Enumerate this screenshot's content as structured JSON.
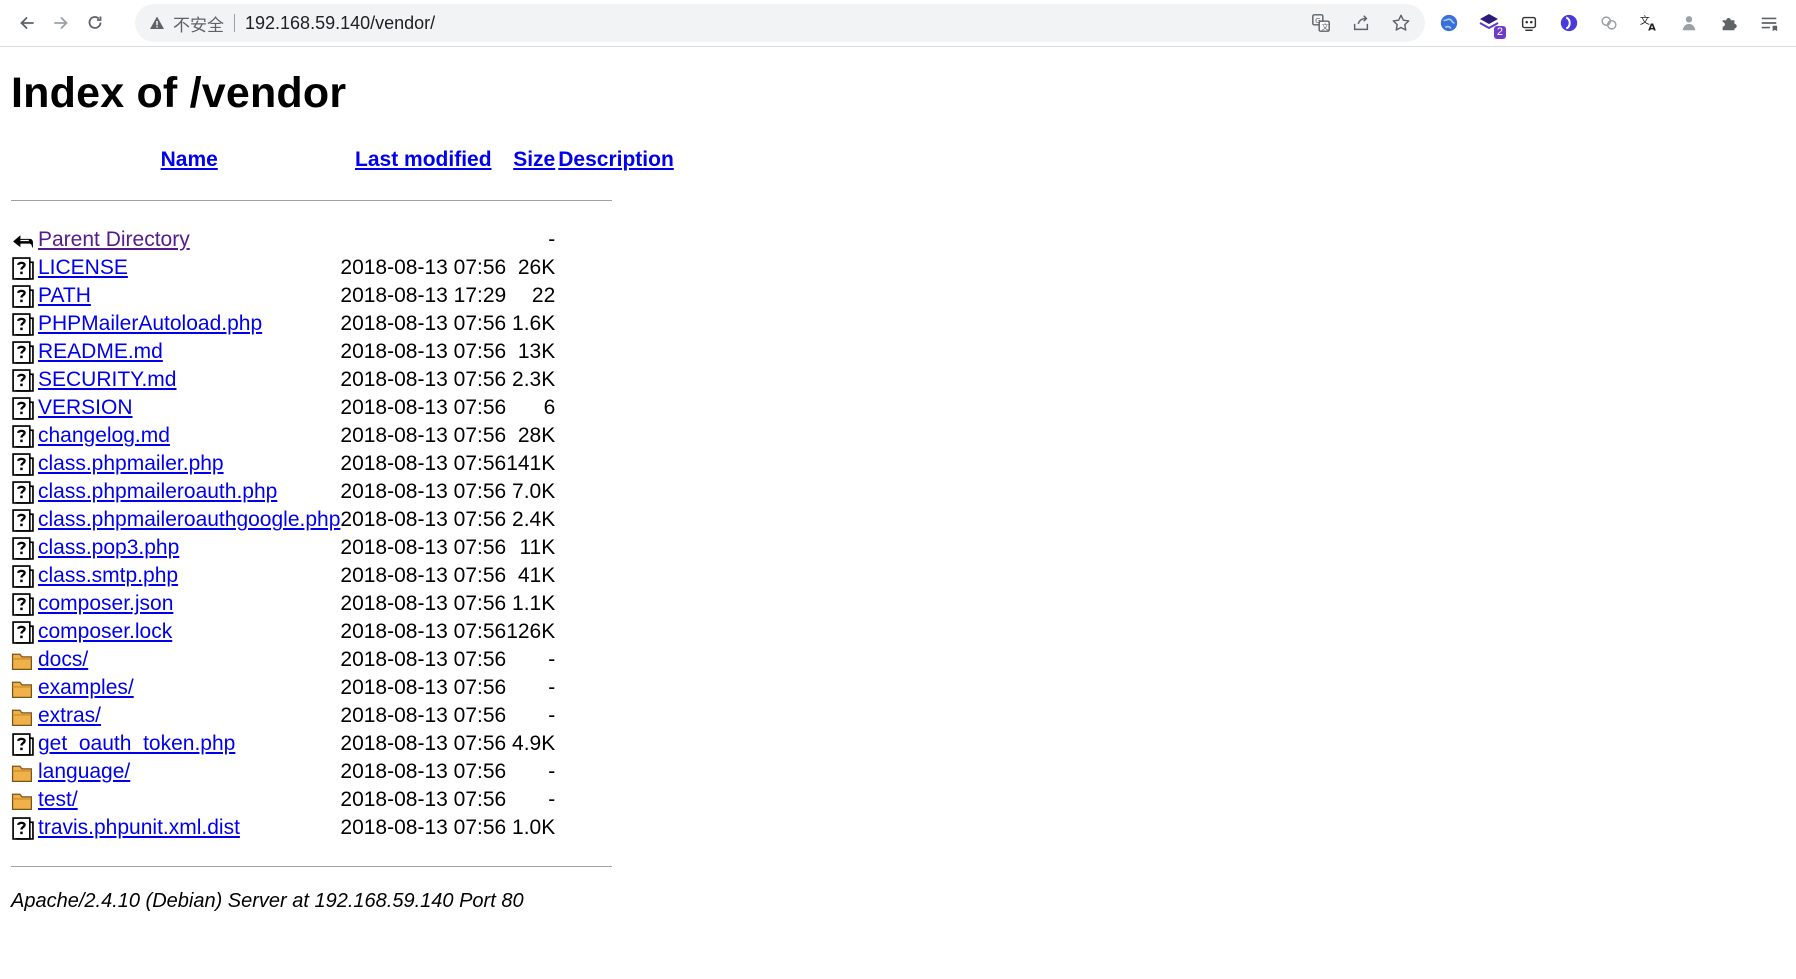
{
  "browser": {
    "security_label": "不安全",
    "url": "192.168.59.140/vendor/",
    "extension_badge": "2"
  },
  "page": {
    "title": "Index of /vendor",
    "columns": {
      "name": "Name",
      "last_modified": "Last modified",
      "size": "Size",
      "description": "Description"
    },
    "parent": {
      "label": "Parent Directory",
      "size": "-"
    },
    "entries": [
      {
        "name": "LICENSE",
        "date": "2018-08-13 07:56",
        "size": "26K",
        "type": "file"
      },
      {
        "name": "PATH",
        "date": "2018-08-13 17:29",
        "size": "22",
        "type": "file"
      },
      {
        "name": "PHPMailerAutoload.php",
        "date": "2018-08-13 07:56",
        "size": "1.6K",
        "type": "file"
      },
      {
        "name": "README.md",
        "date": "2018-08-13 07:56",
        "size": "13K",
        "type": "file"
      },
      {
        "name": "SECURITY.md",
        "date": "2018-08-13 07:56",
        "size": "2.3K",
        "type": "file"
      },
      {
        "name": "VERSION",
        "date": "2018-08-13 07:56",
        "size": "6",
        "type": "file"
      },
      {
        "name": "changelog.md",
        "date": "2018-08-13 07:56",
        "size": "28K",
        "type": "file"
      },
      {
        "name": "class.phpmailer.php",
        "date": "2018-08-13 07:56",
        "size": "141K",
        "type": "file"
      },
      {
        "name": "class.phpmaileroauth.php",
        "date": "2018-08-13 07:56",
        "size": "7.0K",
        "type": "file"
      },
      {
        "name": "class.phpmaileroauthgoogle.php",
        "date": "2018-08-13 07:56",
        "size": "2.4K",
        "type": "file"
      },
      {
        "name": "class.pop3.php",
        "date": "2018-08-13 07:56",
        "size": "11K",
        "type": "file"
      },
      {
        "name": "class.smtp.php",
        "date": "2018-08-13 07:56",
        "size": "41K",
        "type": "file"
      },
      {
        "name": "composer.json",
        "date": "2018-08-13 07:56",
        "size": "1.1K",
        "type": "file"
      },
      {
        "name": "composer.lock",
        "date": "2018-08-13 07:56",
        "size": "126K",
        "type": "file"
      },
      {
        "name": "docs/",
        "date": "2018-08-13 07:56",
        "size": "-",
        "type": "folder"
      },
      {
        "name": "examples/",
        "date": "2018-08-13 07:56",
        "size": "-",
        "type": "folder"
      },
      {
        "name": "extras/",
        "date": "2018-08-13 07:56",
        "size": "-",
        "type": "folder"
      },
      {
        "name": "get_oauth_token.php",
        "date": "2018-08-13 07:56",
        "size": "4.9K",
        "type": "file"
      },
      {
        "name": "language/",
        "date": "2018-08-13 07:56",
        "size": "-",
        "type": "folder"
      },
      {
        "name": "test/",
        "date": "2018-08-13 07:56",
        "size": "-",
        "type": "folder"
      },
      {
        "name": "travis.phpunit.xml.dist",
        "date": "2018-08-13 07:56",
        "size": "1.0K",
        "type": "file"
      }
    ],
    "footer": "Apache/2.4.10 (Debian) Server at 192.168.59.140 Port 80"
  }
}
